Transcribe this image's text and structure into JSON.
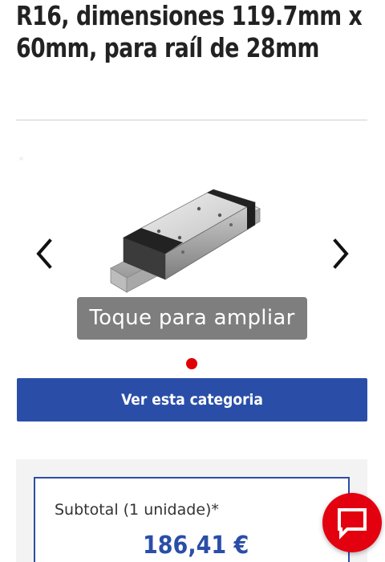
{
  "product": {
    "title": "R16, dimensiones 119.7mm x 60mm, para raíl de 28mm"
  },
  "gallery": {
    "prev_icon": "chevron-left-icon",
    "next_icon": "chevron-right-icon",
    "zoom_hint": "Toque para ampliar",
    "active_dot_color": "#e00000"
  },
  "actions": {
    "category_button": "Ver esta categoria"
  },
  "summary": {
    "subtotal_label": "Subtotal (1 unidade)*",
    "subtotal_value": "186,41 €"
  },
  "chat": {
    "icon": "chat-icon",
    "color": "#e3000f"
  },
  "colors": {
    "brand_blue": "#2a4ea8",
    "accent_red": "#e3000f"
  }
}
